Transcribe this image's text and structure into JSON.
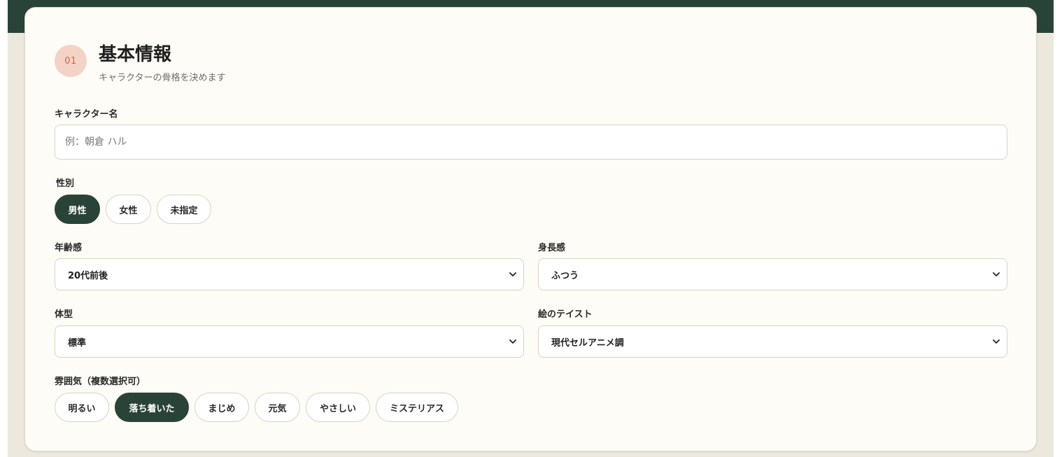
{
  "section": {
    "step_number": "01",
    "title": "基本情報",
    "subtitle": "キャラクターの骨格を決めます"
  },
  "fields": {
    "name": {
      "label": "キャラクター名",
      "value": "",
      "placeholder": "例：朝倉 ハル"
    },
    "gender": {
      "label": "性別",
      "options": [
        {
          "label": "男性",
          "selected": true
        },
        {
          "label": "女性",
          "selected": false
        },
        {
          "label": "未指定",
          "selected": false
        }
      ]
    },
    "age": {
      "label": "年齢感",
      "value": "20代前後"
    },
    "height": {
      "label": "身長感",
      "value": "ふつう"
    },
    "body_type": {
      "label": "体型",
      "value": "標準"
    },
    "art_style": {
      "label": "絵のテイスト",
      "value": "現代セルアニメ調"
    },
    "mood": {
      "label": "雰囲気（複数選択可）",
      "options": [
        {
          "label": "明るい",
          "selected": false
        },
        {
          "label": "落ち着いた",
          "selected": true
        },
        {
          "label": "まじめ",
          "selected": false
        },
        {
          "label": "元気",
          "selected": false
        },
        {
          "label": "やさしい",
          "selected": false
        },
        {
          "label": "ミステリアス",
          "selected": false
        }
      ]
    }
  },
  "colors": {
    "header_green": "#2a4338",
    "badge_bg": "#f3d3c6",
    "badge_text": "#d4624a",
    "card_bg": "#fdfcf6",
    "page_bg": "#ece8de"
  },
  "icons": {
    "select_arrow": "chevron-down-icon"
  }
}
